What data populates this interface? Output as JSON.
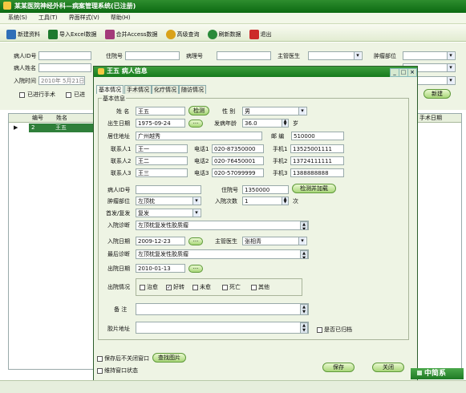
{
  "app": {
    "title": "某某医院神经外科—病案管理系统(已注册)"
  },
  "menu": [
    "系统(S)",
    "工具(T)",
    "界面样式(V)",
    "帮助(H)"
  ],
  "toolbar": [
    {
      "label": "新建资料",
      "icon": "new-record-icon",
      "color": "#2f6fb8"
    },
    {
      "label": "导入Excel数据",
      "icon": "excel-icon",
      "color": "#1e7a2e"
    },
    {
      "label": "合并Access数据",
      "icon": "access-icon",
      "color": "#a33a7a"
    },
    {
      "label": "高级查询",
      "icon": "search-icon",
      "color": "#d9a21a"
    },
    {
      "label": "刷新数据",
      "icon": "refresh-icon",
      "color": "#2a8a3a"
    },
    {
      "label": "退出",
      "icon": "exit-icon",
      "color": "#cc2a2a"
    }
  ],
  "filter": {
    "patient_id_label": "病人ID号",
    "patient_name_label": "病人姓名",
    "admit_time_label": "入院时间",
    "hospital_no_label": "住院号",
    "pathology_no_label": "病理号",
    "doctor_label": "主管医生",
    "tumor_site_label": "肿瘤部位",
    "date_value": "2010年 5月21日",
    "surgery_label": "已进行手术",
    "chemo_label": "已进",
    "new_button": "新建"
  },
  "grid": {
    "headers": [
      "编号",
      "姓名"
    ],
    "right_header": "手术日期",
    "rows": [
      {
        "id": "2",
        "name": "王五"
      }
    ]
  },
  "dialog": {
    "title": "王五  病人信息",
    "tabs": [
      "基本情况",
      "手术情况",
      "化疗情况",
      "随访情况"
    ],
    "group_title": "基本信息",
    "name_label": "姓  名",
    "name_value": "王五",
    "check_button": "检测",
    "gender_label": "性  别",
    "gender_value": "男",
    "dob_label": "出生日期",
    "dob_value": "1975-09-24",
    "onset_age_label": "发病年龄",
    "onset_age_value": "36.0",
    "age_unit": "岁",
    "address_label": "居住地址",
    "address_value": "广州越秀",
    "postcode_label": "邮  编",
    "postcode_value": "510000",
    "contacts": [
      {
        "label": "联系人1",
        "name": "王一",
        "phone_label": "电话1",
        "phone": "020-87350000",
        "mobile_label": "手机1",
        "mobile": "13525001111"
      },
      {
        "label": "联系人2",
        "name": "王二",
        "phone_label": "电话2",
        "phone": "020-76450001",
        "mobile_label": "手机2",
        "mobile": "13724111111"
      },
      {
        "label": "联系人3",
        "name": "王三",
        "phone_label": "电话3",
        "phone": "020-57099999",
        "mobile_label": "手机3",
        "mobile": "1388888888"
      }
    ],
    "pid_label": "病人ID号",
    "pid_value": "",
    "hospno_label": "住院号",
    "hospno_value": "1350000",
    "check_load_button": "检测并加载",
    "tumor_label": "肿瘤部位",
    "tumor_value": "左顶枕",
    "admit_count_label": "入院次数",
    "admit_count_value": "1",
    "admit_count_unit": "次",
    "first_label": "首发/复发",
    "first_value": "复发",
    "admit_diag_label": "入院诊断",
    "admit_diag_value": "左顶枕复发性胶质瘤",
    "admit_date_label": "入院日期",
    "admit_date_value": "2009-12-23",
    "doctor_label": "主管医生",
    "doctor_value": "张相青",
    "final_diag_label": "最后诊断",
    "final_diag_value": "左顶枕复发性胶质瘤",
    "discharge_label": "出院日期",
    "discharge_value": "2010-01-13",
    "outcome_label": "出院情况",
    "outcomes": [
      {
        "label": "治愈",
        "checked": false
      },
      {
        "label": "好转",
        "checked": true
      },
      {
        "label": "未愈",
        "checked": false
      },
      {
        "label": "死亡",
        "checked": false
      },
      {
        "label": "其他",
        "checked": false
      }
    ],
    "note_label": "备  注",
    "note_value": "",
    "film_label": "胶片地址",
    "film_value": "",
    "archived_label": "是否已归档",
    "keep_open_label": "保存后不关闭窗口",
    "find_image_button": "查找图片",
    "keep_state_label": "维持窗口状态",
    "save_button": "保存",
    "close_button": "关闭"
  },
  "brand": "中简系"
}
